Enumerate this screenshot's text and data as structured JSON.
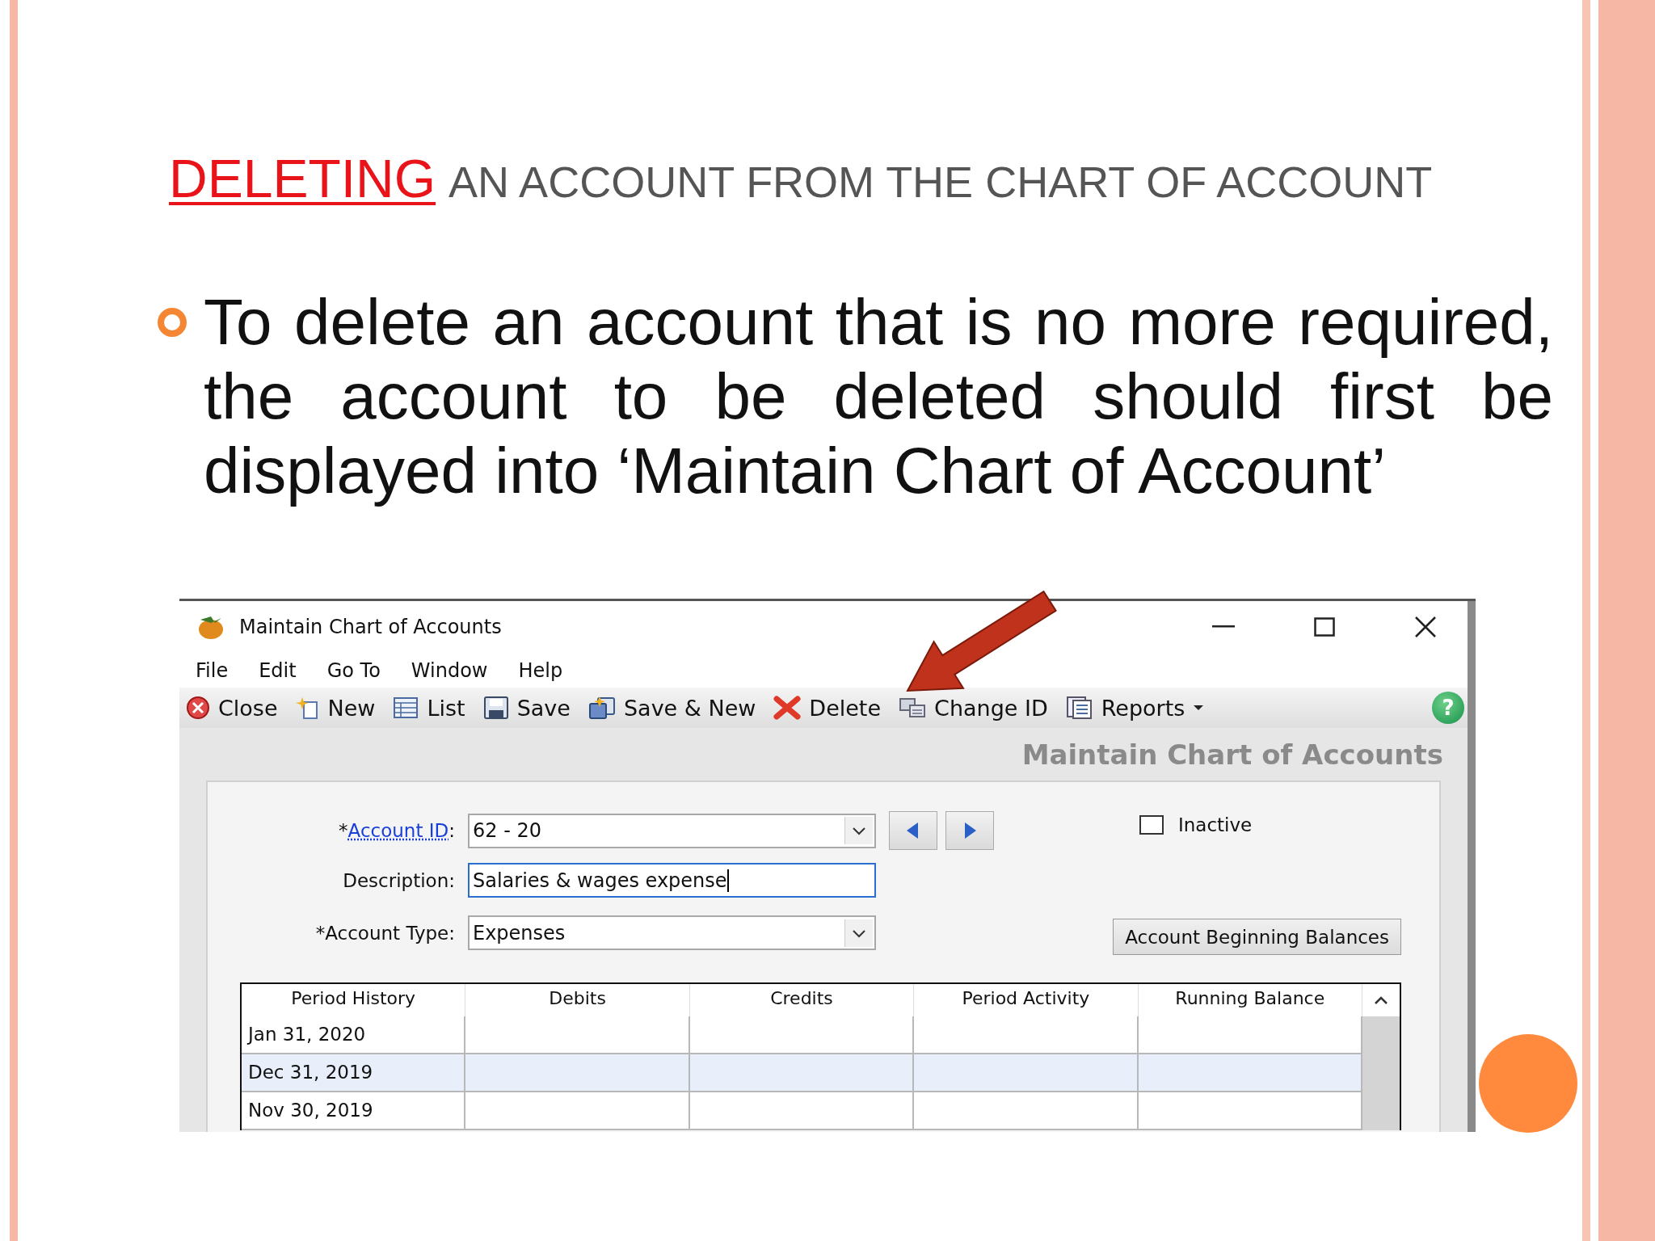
{
  "slide": {
    "title": {
      "highlight": "DELETING",
      "rest": "AN ACCOUNT FROM THE CHART OF ACCOUNT"
    },
    "bullets": [
      "To delete an account that is no more required, the account to be deleted should first be displayed into ‘Maintain Chart of Account’"
    ]
  },
  "window": {
    "title": "Maintain Chart of Accounts",
    "menu": [
      "File",
      "Edit",
      "Go To",
      "Window",
      "Help"
    ],
    "toolbar": [
      {
        "label": "Close",
        "kind": "button"
      },
      {
        "label": "New",
        "kind": "button"
      },
      {
        "label": "List",
        "kind": "button"
      },
      {
        "label": "Save",
        "kind": "button"
      },
      {
        "label": "Save & New",
        "kind": "button"
      },
      {
        "label": "Delete",
        "kind": "button"
      },
      {
        "label": "Change ID",
        "kind": "button"
      },
      {
        "label": "Reports",
        "kind": "dropdown"
      }
    ],
    "help": "?",
    "header": "Maintain Chart of Accounts",
    "form": {
      "account_id": {
        "required": "*",
        "label": "Account ID",
        "colon": ":",
        "value": "62 - 20"
      },
      "description": {
        "label": "Description:",
        "value": "Salaries & wages expense",
        "focused": true
      },
      "account_type": {
        "label": "*Account Type:",
        "value": "Expenses"
      },
      "inactive": {
        "label": "Inactive",
        "checked": false
      },
      "beginning_balances": "Account Beginning Balances"
    },
    "table": {
      "columns": [
        "Period History",
        "Debits",
        "Credits",
        "Period Activity",
        "Running Balance"
      ],
      "rows": [
        {
          "period": "Jan 31, 2020",
          "selected": false
        },
        {
          "period": "Dec 31, 2019",
          "selected": true
        },
        {
          "period": "Nov 30, 2019",
          "selected": false
        }
      ]
    }
  }
}
